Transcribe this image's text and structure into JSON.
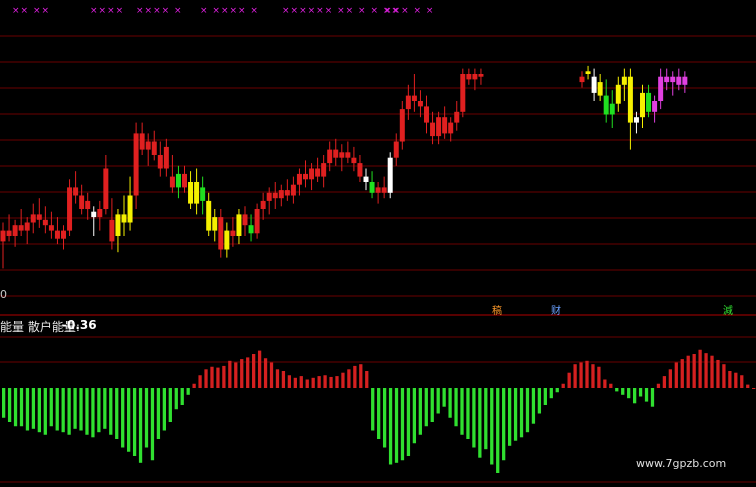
{
  "colors": {
    "background": "#000000",
    "grid": "#6a0000",
    "divider": "#b00000",
    "candle_up": "#e02020",
    "candle_down": "#e02020",
    "candle_yellow": "#f5f000",
    "candle_green": "#20e020",
    "candle_magenta": "#e040e0",
    "candle_white": "#ffffff",
    "hist_positive": "#d52020",
    "hist_negative": "#30e030"
  },
  "top_markers": [
    "×× ××",
    "××××",
    "×××× ×",
    "× ×××× ×",
    "×××××× ×× × × ××",
    "××× × ×"
  ],
  "event_tags": [
    {
      "text": "稿",
      "color": "#ff9a2a"
    },
    {
      "text": "财",
      "color": "#6aa0ff"
    },
    {
      "text": "減",
      "color": "#30e030"
    }
  ],
  "axis_zero_label": "0",
  "panel_title": "能量 散户能量:",
  "panel_value": "-0.36",
  "watermark": "www.7gpzb.com",
  "chart_data": [
    {
      "type": "candlestick",
      "title": "",
      "xlabel": "",
      "ylabel": "",
      "grid": true,
      "ylim": [
        0,
        100
      ],
      "candles": [
        {
          "o": 18,
          "h": 25,
          "l": 8,
          "c": 22,
          "color": "red"
        },
        {
          "o": 22,
          "h": 28,
          "l": 18,
          "c": 20,
          "color": "red"
        },
        {
          "o": 20,
          "h": 26,
          "l": 16,
          "c": 24,
          "color": "red"
        },
        {
          "o": 24,
          "h": 30,
          "l": 20,
          "c": 22,
          "color": "red"
        },
        {
          "o": 22,
          "h": 27,
          "l": 17,
          "c": 25,
          "color": "red"
        },
        {
          "o": 25,
          "h": 32,
          "l": 21,
          "c": 28,
          "color": "red"
        },
        {
          "o": 28,
          "h": 34,
          "l": 23,
          "c": 26,
          "color": "red"
        },
        {
          "o": 26,
          "h": 31,
          "l": 21,
          "c": 24,
          "color": "red"
        },
        {
          "o": 24,
          "h": 29,
          "l": 19,
          "c": 22,
          "color": "red"
        },
        {
          "o": 22,
          "h": 27,
          "l": 17,
          "c": 19,
          "color": "red"
        },
        {
          "o": 19,
          "h": 24,
          "l": 15,
          "c": 22,
          "color": "red"
        },
        {
          "o": 22,
          "h": 41,
          "l": 20,
          "c": 38,
          "color": "red"
        },
        {
          "o": 38,
          "h": 44,
          "l": 32,
          "c": 35,
          "color": "red"
        },
        {
          "o": 35,
          "h": 39,
          "l": 28,
          "c": 30,
          "color": "red"
        },
        {
          "o": 30,
          "h": 36,
          "l": 26,
          "c": 33,
          "color": "red"
        },
        {
          "o": 29,
          "h": 31,
          "l": 20,
          "c": 27,
          "color": "white"
        },
        {
          "o": 27,
          "h": 33,
          "l": 22,
          "c": 30,
          "color": "red"
        },
        {
          "o": 30,
          "h": 50,
          "l": 28,
          "c": 45,
          "color": "red"
        },
        {
          "o": 26,
          "h": 34,
          "l": 15,
          "c": 18,
          "color": "red"
        },
        {
          "o": 20,
          "h": 30,
          "l": 14,
          "c": 28,
          "color": "yellow"
        },
        {
          "o": 28,
          "h": 35,
          "l": 20,
          "c": 25,
          "color": "yellow"
        },
        {
          "o": 25,
          "h": 42,
          "l": 22,
          "c": 35,
          "color": "yellow"
        },
        {
          "o": 35,
          "h": 62,
          "l": 30,
          "c": 58,
          "color": "red"
        },
        {
          "o": 58,
          "h": 62,
          "l": 50,
          "c": 52,
          "color": "red"
        },
        {
          "o": 52,
          "h": 58,
          "l": 46,
          "c": 55,
          "color": "red"
        },
        {
          "o": 55,
          "h": 59,
          "l": 48,
          "c": 50,
          "color": "red"
        },
        {
          "o": 50,
          "h": 55,
          "l": 42,
          "c": 45,
          "color": "red"
        },
        {
          "o": 45,
          "h": 56,
          "l": 42,
          "c": 53,
          "color": "red"
        },
        {
          "o": 42,
          "h": 50,
          "l": 36,
          "c": 38,
          "color": "red"
        },
        {
          "o": 38,
          "h": 46,
          "l": 34,
          "c": 43,
          "color": "green"
        },
        {
          "o": 43,
          "h": 46,
          "l": 36,
          "c": 38,
          "color": "red"
        },
        {
          "o": 40,
          "h": 44,
          "l": 30,
          "c": 32,
          "color": "yellow"
        },
        {
          "o": 32,
          "h": 45,
          "l": 28,
          "c": 40,
          "color": "yellow"
        },
        {
          "o": 38,
          "h": 42,
          "l": 28,
          "c": 33,
          "color": "green"
        },
        {
          "o": 33,
          "h": 36,
          "l": 20,
          "c": 22,
          "color": "yellow"
        },
        {
          "o": 22,
          "h": 30,
          "l": 18,
          "c": 27,
          "color": "yellow"
        },
        {
          "o": 27,
          "h": 30,
          "l": 12,
          "c": 15,
          "color": "red"
        },
        {
          "o": 15,
          "h": 25,
          "l": 12,
          "c": 22,
          "color": "yellow"
        },
        {
          "o": 22,
          "h": 27,
          "l": 16,
          "c": 20,
          "color": "red"
        },
        {
          "o": 20,
          "h": 30,
          "l": 17,
          "c": 28,
          "color": "yellow"
        },
        {
          "o": 28,
          "h": 31,
          "l": 20,
          "c": 24,
          "color": "red"
        },
        {
          "o": 24,
          "h": 28,
          "l": 18,
          "c": 21,
          "color": "green"
        },
        {
          "o": 21,
          "h": 32,
          "l": 19,
          "c": 30,
          "color": "red"
        },
        {
          "o": 30,
          "h": 36,
          "l": 26,
          "c": 33,
          "color": "red"
        },
        {
          "o": 33,
          "h": 38,
          "l": 28,
          "c": 36,
          "color": "red"
        },
        {
          "o": 36,
          "h": 40,
          "l": 30,
          "c": 34,
          "color": "red"
        },
        {
          "o": 34,
          "h": 39,
          "l": 31,
          "c": 37,
          "color": "red"
        },
        {
          "o": 37,
          "h": 41,
          "l": 33,
          "c": 35,
          "color": "red"
        },
        {
          "o": 35,
          "h": 42,
          "l": 32,
          "c": 39,
          "color": "red"
        },
        {
          "o": 39,
          "h": 45,
          "l": 35,
          "c": 43,
          "color": "red"
        },
        {
          "o": 43,
          "h": 48,
          "l": 38,
          "c": 41,
          "color": "red"
        },
        {
          "o": 41,
          "h": 47,
          "l": 37,
          "c": 45,
          "color": "red"
        },
        {
          "o": 45,
          "h": 49,
          "l": 40,
          "c": 42,
          "color": "red"
        },
        {
          "o": 42,
          "h": 50,
          "l": 38,
          "c": 47,
          "color": "red"
        },
        {
          "o": 47,
          "h": 55,
          "l": 44,
          "c": 52,
          "color": "red"
        },
        {
          "o": 52,
          "h": 56,
          "l": 46,
          "c": 49,
          "color": "red"
        },
        {
          "o": 49,
          "h": 54,
          "l": 44,
          "c": 51,
          "color": "red"
        },
        {
          "o": 51,
          "h": 55,
          "l": 47,
          "c": 49,
          "color": "red"
        },
        {
          "o": 49,
          "h": 53,
          "l": 44,
          "c": 47,
          "color": "red"
        },
        {
          "o": 47,
          "h": 50,
          "l": 40,
          "c": 42,
          "color": "red"
        },
        {
          "o": 42,
          "h": 45,
          "l": 37,
          "c": 40,
          "color": "white"
        },
        {
          "o": 40,
          "h": 44,
          "l": 34,
          "c": 36,
          "color": "green"
        },
        {
          "o": 36,
          "h": 40,
          "l": 32,
          "c": 38,
          "color": "red"
        },
        {
          "o": 38,
          "h": 42,
          "l": 34,
          "c": 36,
          "color": "red"
        },
        {
          "o": 36,
          "h": 51,
          "l": 34,
          "c": 49,
          "color": "white"
        },
        {
          "o": 49,
          "h": 58,
          "l": 46,
          "c": 55,
          "color": "red"
        },
        {
          "o": 55,
          "h": 70,
          "l": 52,
          "c": 67,
          "color": "red"
        },
        {
          "o": 67,
          "h": 76,
          "l": 63,
          "c": 72,
          "color": "red"
        },
        {
          "o": 72,
          "h": 80,
          "l": 66,
          "c": 70,
          "color": "red"
        },
        {
          "o": 70,
          "h": 74,
          "l": 64,
          "c": 68,
          "color": "red"
        },
        {
          "o": 68,
          "h": 72,
          "l": 58,
          "c": 62,
          "color": "red"
        },
        {
          "o": 62,
          "h": 66,
          "l": 54,
          "c": 57,
          "color": "red"
        },
        {
          "o": 57,
          "h": 66,
          "l": 54,
          "c": 64,
          "color": "red"
        },
        {
          "o": 64,
          "h": 68,
          "l": 56,
          "c": 58,
          "color": "red"
        },
        {
          "o": 58,
          "h": 64,
          "l": 55,
          "c": 62,
          "color": "red"
        },
        {
          "o": 62,
          "h": 70,
          "l": 59,
          "c": 66,
          "color": "red"
        },
        {
          "o": 66,
          "h": 82,
          "l": 64,
          "c": 80,
          "color": "red"
        },
        {
          "o": 80,
          "h": 82,
          "l": 76,
          "c": 78,
          "color": "red"
        },
        {
          "o": 78,
          "h": 82,
          "l": 74,
          "c": 80,
          "color": "red"
        },
        {
          "o": 80,
          "h": 82,
          "l": 76,
          "c": 79,
          "color": "red"
        },
        {
          "o": 79,
          "h": 81,
          "l": 75,
          "c": 77,
          "color": "red"
        },
        {
          "o": 80,
          "h": 83,
          "l": 78,
          "c": 81,
          "color": "yellow"
        },
        {
          "o": 79,
          "h": 82,
          "l": 70,
          "c": 73,
          "color": "white"
        },
        {
          "o": 77,
          "h": 80,
          "l": 70,
          "c": 72,
          "color": "yellow"
        },
        {
          "o": 72,
          "h": 78,
          "l": 62,
          "c": 65,
          "color": "green"
        },
        {
          "o": 65,
          "h": 74,
          "l": 60,
          "c": 69,
          "color": "green"
        },
        {
          "o": 69,
          "h": 79,
          "l": 66,
          "c": 76,
          "color": "yellow"
        },
        {
          "o": 76,
          "h": 82,
          "l": 70,
          "c": 79,
          "color": "yellow"
        },
        {
          "o": 79,
          "h": 82,
          "l": 52,
          "c": 62,
          "color": "yellow"
        },
        {
          "o": 62,
          "h": 66,
          "l": 58,
          "c": 64,
          "color": "white"
        },
        {
          "o": 64,
          "h": 76,
          "l": 60,
          "c": 73,
          "color": "yellow"
        },
        {
          "o": 73,
          "h": 76,
          "l": 64,
          "c": 66,
          "color": "green"
        },
        {
          "o": 66,
          "h": 72,
          "l": 62,
          "c": 70,
          "color": "magenta"
        },
        {
          "o": 70,
          "h": 82,
          "l": 67,
          "c": 79,
          "color": "magenta"
        },
        {
          "o": 79,
          "h": 82,
          "l": 74,
          "c": 77,
          "color": "magenta"
        },
        {
          "o": 77,
          "h": 81,
          "l": 72,
          "c": 79,
          "color": "magenta"
        },
        {
          "o": 79,
          "h": 82,
          "l": 74,
          "c": 76,
          "color": "magenta"
        },
        {
          "o": 76,
          "h": 81,
          "l": 73,
          "c": 79,
          "color": "magenta"
        }
      ]
    },
    {
      "type": "bar",
      "title": "",
      "xlabel": "",
      "ylabel": "",
      "ylim": [
        -100,
        50
      ],
      "values": [
        -35,
        -40,
        -45,
        -45,
        -50,
        -48,
        -52,
        -55,
        -45,
        -50,
        -52,
        -55,
        -48,
        -50,
        -55,
        -58,
        -52,
        -48,
        -55,
        -60,
        -70,
        -75,
        -80,
        -88,
        -70,
        -85,
        -60,
        -50,
        -40,
        -25,
        -20,
        -8,
        5,
        15,
        22,
        25,
        24,
        26,
        32,
        30,
        34,
        36,
        40,
        44,
        35,
        30,
        22,
        20,
        15,
        12,
        14,
        10,
        12,
        14,
        15,
        13,
        14,
        18,
        22,
        26,
        28,
        20,
        -50,
        -60,
        -70,
        -90,
        -88,
        -85,
        -80,
        -65,
        -55,
        -45,
        -40,
        -30,
        -22,
        -35,
        -45,
        -55,
        -60,
        -70,
        -82,
        -72,
        -90,
        -100,
        -85,
        -68,
        -62,
        -58,
        -52,
        -42,
        -30,
        -20,
        -12,
        -5,
        5,
        18,
        28,
        30,
        32,
        28,
        25,
        10,
        5,
        -4,
        -8,
        -12,
        -18,
        -10,
        -16,
        -22,
        5,
        14,
        22,
        30,
        34,
        38,
        40,
        45,
        41,
        38,
        33,
        28,
        20,
        18,
        15,
        4,
        0
      ]
    }
  ]
}
